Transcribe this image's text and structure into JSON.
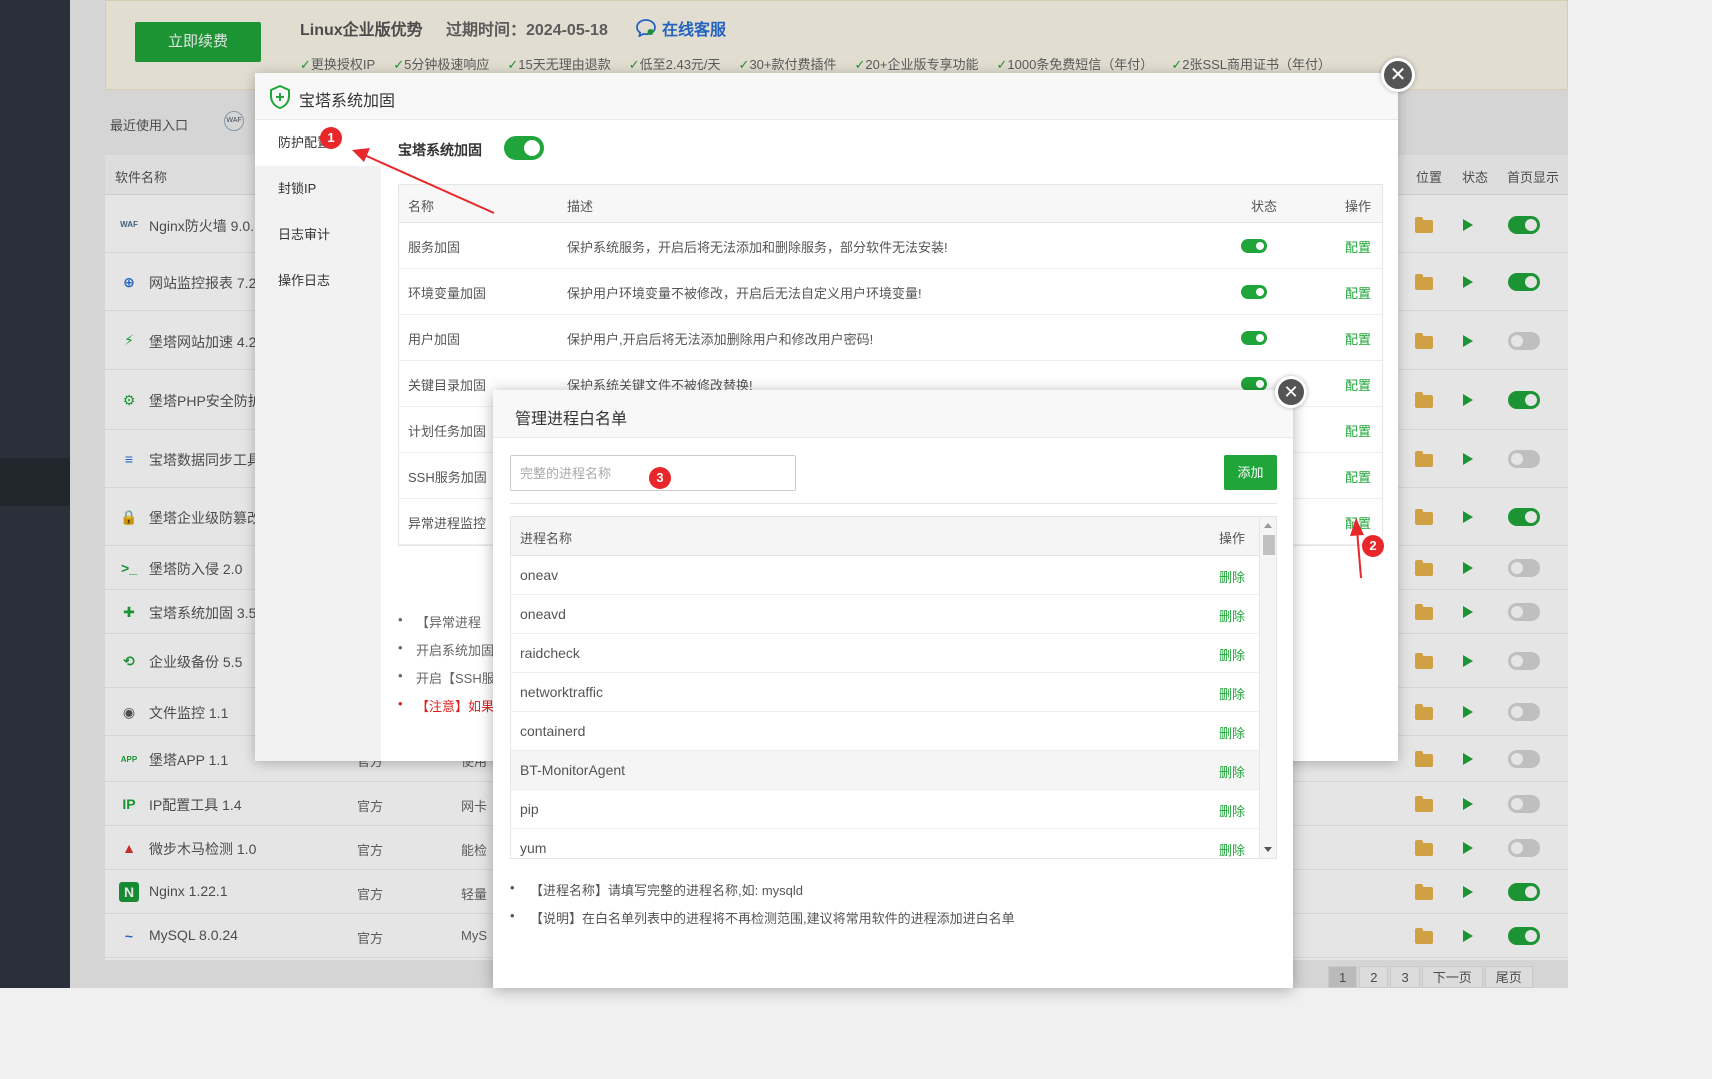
{
  "banner": {
    "renew_label": "立即续费",
    "title": "Linux企业版优势",
    "expire": "过期时间：2024-05-18",
    "service": "在线客服",
    "features": [
      "更换授权IP",
      "5分钟极速响应",
      "15天无理由退款",
      "低至2.43元/天",
      "30+款付费插件",
      "20+企业版专享功能",
      "1000条免费短信（年付）",
      "2张SSL商用证书（年付）"
    ]
  },
  "recent": {
    "label": "最近使用入口"
  },
  "plugin_list": {
    "headers": {
      "name": "软件名称",
      "location": "位置",
      "status": "状态",
      "home": "首页显示"
    },
    "rows": [
      {
        "name": "Nginx防火墙 9.0.",
        "type": "",
        "desc": "",
        "home_on": true,
        "icon": "waf-icon"
      },
      {
        "name": "网站监控报表 7.2",
        "type": "",
        "desc": "",
        "home_on": true,
        "icon": "globe-icon"
      },
      {
        "name": "堡塔网站加速 4.2",
        "type": "",
        "desc": "",
        "home_on": false,
        "icon": "bolt-icon"
      },
      {
        "name": "堡塔PHP安全防护",
        "type": "",
        "desc": "",
        "home_on": true,
        "icon": "php-shield-icon"
      },
      {
        "name": "宝塔数据同步工具",
        "type": "",
        "desc": "",
        "home_on": false,
        "icon": "database-icon"
      },
      {
        "name": "堡塔企业级防篡改",
        "type": "",
        "desc": "",
        "home_on": true,
        "icon": "lock-icon"
      },
      {
        "name": "堡塔防入侵 2.0",
        "type": "",
        "desc": "",
        "home_on": false,
        "icon": "terminal-icon"
      },
      {
        "name": "宝塔系统加固 3.5",
        "type": "",
        "desc": "",
        "home_on": false,
        "icon": "shield-icon"
      },
      {
        "name": "企业级备份 5.5",
        "type": "",
        "desc": "",
        "home_on": false,
        "icon": "backup-icon"
      },
      {
        "name": "文件监控 1.1",
        "type": "",
        "desc": "",
        "home_on": false,
        "icon": "folder-eye-icon"
      },
      {
        "name": "堡塔APP 1.1",
        "type": "官方",
        "desc": "使用",
        "home_on": false,
        "icon": "app-icon"
      },
      {
        "name": "IP配置工具 1.4",
        "type": "官方",
        "desc": "网卡",
        "home_on": false,
        "icon": "ip-icon"
      },
      {
        "name": "微步木马检测 1.0",
        "type": "官方",
        "desc": "能检",
        "home_on": false,
        "icon": "trojan-icon"
      },
      {
        "name": "Nginx 1.22.1",
        "type": "官方",
        "desc": "轻量",
        "home_on": true,
        "icon": "nginx-icon"
      },
      {
        "name": "MySQL 8.0.24",
        "type": "官方",
        "desc": "MyS",
        "home_on": true,
        "icon": "mysql-icon"
      }
    ],
    "pager": [
      "1",
      "2",
      "3",
      "下一页",
      "尾页"
    ]
  },
  "hardening_modal": {
    "title": "宝塔系统加固",
    "nav": [
      "防护配置",
      "封锁IP",
      "日志审计",
      "操作日志"
    ],
    "master_label": "宝塔系统加固",
    "table_headers": {
      "name": "名称",
      "desc": "描述",
      "status": "状态",
      "action": "操作"
    },
    "rows": [
      {
        "name": "服务加固",
        "desc": "保护系统服务，开启后将无法添加和删除服务，部分软件无法安装!",
        "action": "配置"
      },
      {
        "name": "环境变量加固",
        "desc": "保护用户环境变量不被修改，开启后无法自定义用户环境变量!",
        "action": "配置"
      },
      {
        "name": "用户加固",
        "desc": "保护用户,开启后将无法添加删除用户和修改用户密码!",
        "action": "配置"
      },
      {
        "name": "关键目录加固",
        "desc": "保护系统关键文件不被修改替换!",
        "action": "配置"
      },
      {
        "name": "计划任务加固",
        "desc": "",
        "action": "配置"
      },
      {
        "name": "SSH服务加固",
        "desc": "",
        "action": "配置"
      },
      {
        "name": "异常进程监控",
        "desc": "",
        "action": "配置"
      }
    ],
    "notes": [
      "【异常进程",
      "开启系统加固",
      "开启【SSH服",
      "【注意】如果"
    ]
  },
  "whitelist_modal": {
    "title": "管理进程白名单",
    "input_placeholder": "完整的进程名称",
    "add_label": "添加",
    "headers": {
      "name": "进程名称",
      "action": "操作"
    },
    "delete_label": "删除",
    "processes": [
      "oneav",
      "oneavd",
      "raidcheck",
      "networktraffic",
      "containerd",
      "BT-MonitorAgent",
      "pip",
      "yum"
    ],
    "notes": [
      "【进程名称】请填写完整的进程名称,如: mysqld",
      "【说明】在白名单列表中的进程将不再检测范围,建议将常用软件的进程添加进白名单"
    ]
  },
  "badges": [
    "1",
    "2",
    "3"
  ],
  "colors": {
    "accent": "#20a53a",
    "badge": "#e8272a",
    "warn": "#e02020"
  }
}
